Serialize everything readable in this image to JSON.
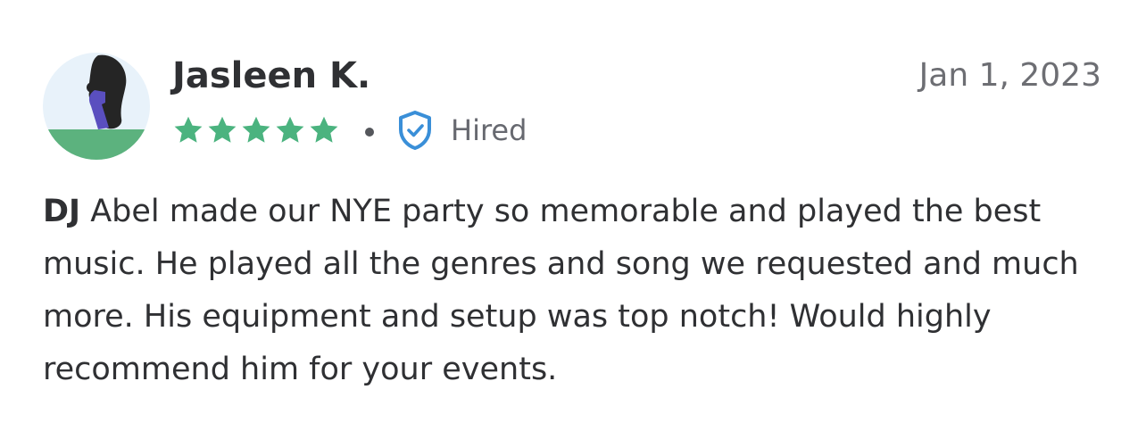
{
  "review": {
    "reviewer_name": "Jasleen K.",
    "date": "Jan 1, 2023",
    "rating": 5,
    "rating_max": 5,
    "hired_label": "Hired",
    "body_lead": "DJ",
    "body_rest": " Abel made our NYE party so memorable and played the best music. He played all the genres and song we requested and much more. His equipment and setup was top notch! Would highly recommend him for your events."
  },
  "colors": {
    "star": "#4bb37f",
    "hired_shield": "#3a8fd8",
    "avatar_bg": "#e8f2fa",
    "avatar_ground": "#5cb27e",
    "avatar_hair": "#252525",
    "avatar_body": "#5a4fbf"
  },
  "icons": {
    "star": "star-icon",
    "hired": "shield-check-icon",
    "avatar": "avatar-illustration"
  }
}
